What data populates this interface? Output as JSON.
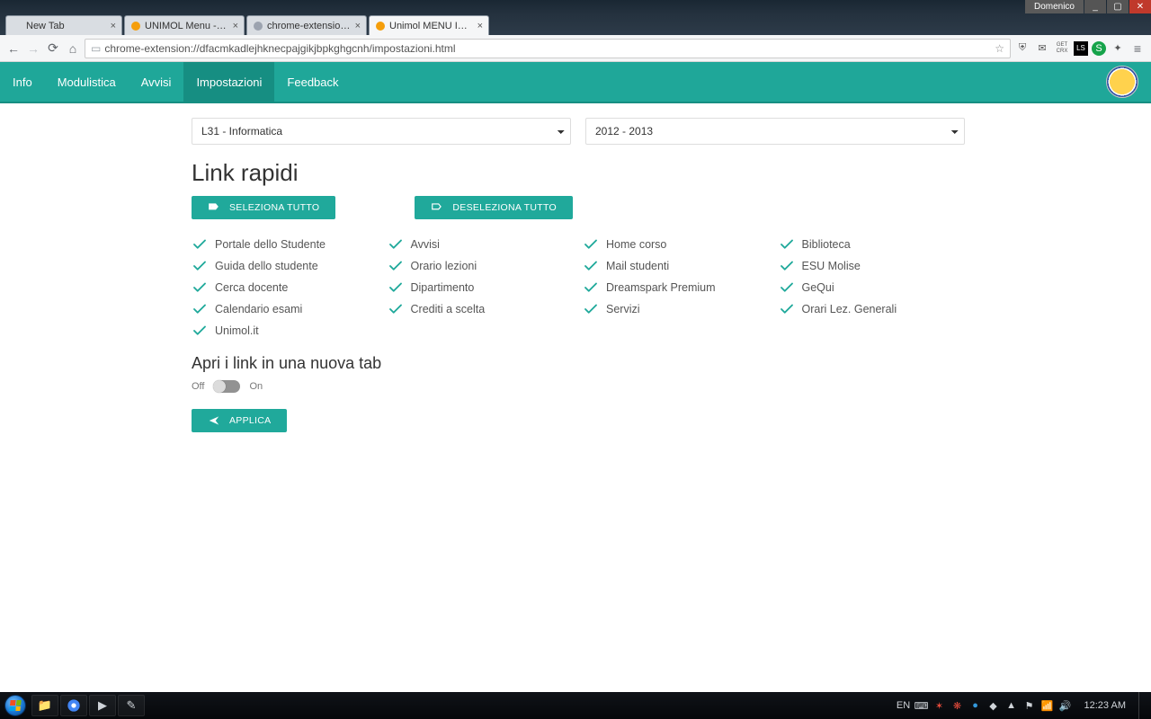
{
  "window": {
    "user": "Domenico",
    "minimize": "_",
    "maximize": "▢",
    "close": "✕"
  },
  "tabs": [
    {
      "title": "New Tab"
    },
    {
      "title": "UNIMOL Menu - Modifica"
    },
    {
      "title": "chrome-extension://dfac…"
    },
    {
      "title": "Unimol MENU Impostazio"
    }
  ],
  "active_tab_index": 3,
  "address": {
    "url": "chrome-extension://dfacmkadlejhknecpajgikjbpkghgcnh/impostazioni.html"
  },
  "ext_icons": {
    "shield": "⛨",
    "mail": "✉",
    "getcrx": "GET\nCRX",
    "ls": "LS",
    "s": "S"
  },
  "nav": {
    "items": [
      "Info",
      "Modulistica",
      "Avvisi",
      "Impostazioni",
      "Feedback"
    ],
    "active_index": 3
  },
  "selects": {
    "course": "L31 - Informatica",
    "year": "2012 - 2013"
  },
  "sections": {
    "linkrapidi_title": "Link rapidi",
    "newtab_title": "Apri i link in una nuova tab"
  },
  "buttons": {
    "select_all": "Seleziona tutto",
    "deselect_all": "Deseleziona tutto",
    "apply": "Applica"
  },
  "links": {
    "col1": [
      "Portale dello Studente",
      "Guida dello studente",
      "Cerca docente",
      "Calendario esami",
      "Unimol.it"
    ],
    "col2": [
      "Avvisi",
      "Orario lezioni",
      "Dipartimento",
      "Crediti a scelta"
    ],
    "col3": [
      "Home corso",
      "Mail studenti",
      "Dreamspark Premium",
      "Servizi"
    ],
    "col4": [
      "Biblioteca",
      "ESU Molise",
      "GeQui",
      "Orari Lez. Generali"
    ]
  },
  "toggle": {
    "off": "Off",
    "on": "On",
    "state": false
  },
  "taskbar": {
    "lang": "EN",
    "clock": "12:23 AM"
  }
}
